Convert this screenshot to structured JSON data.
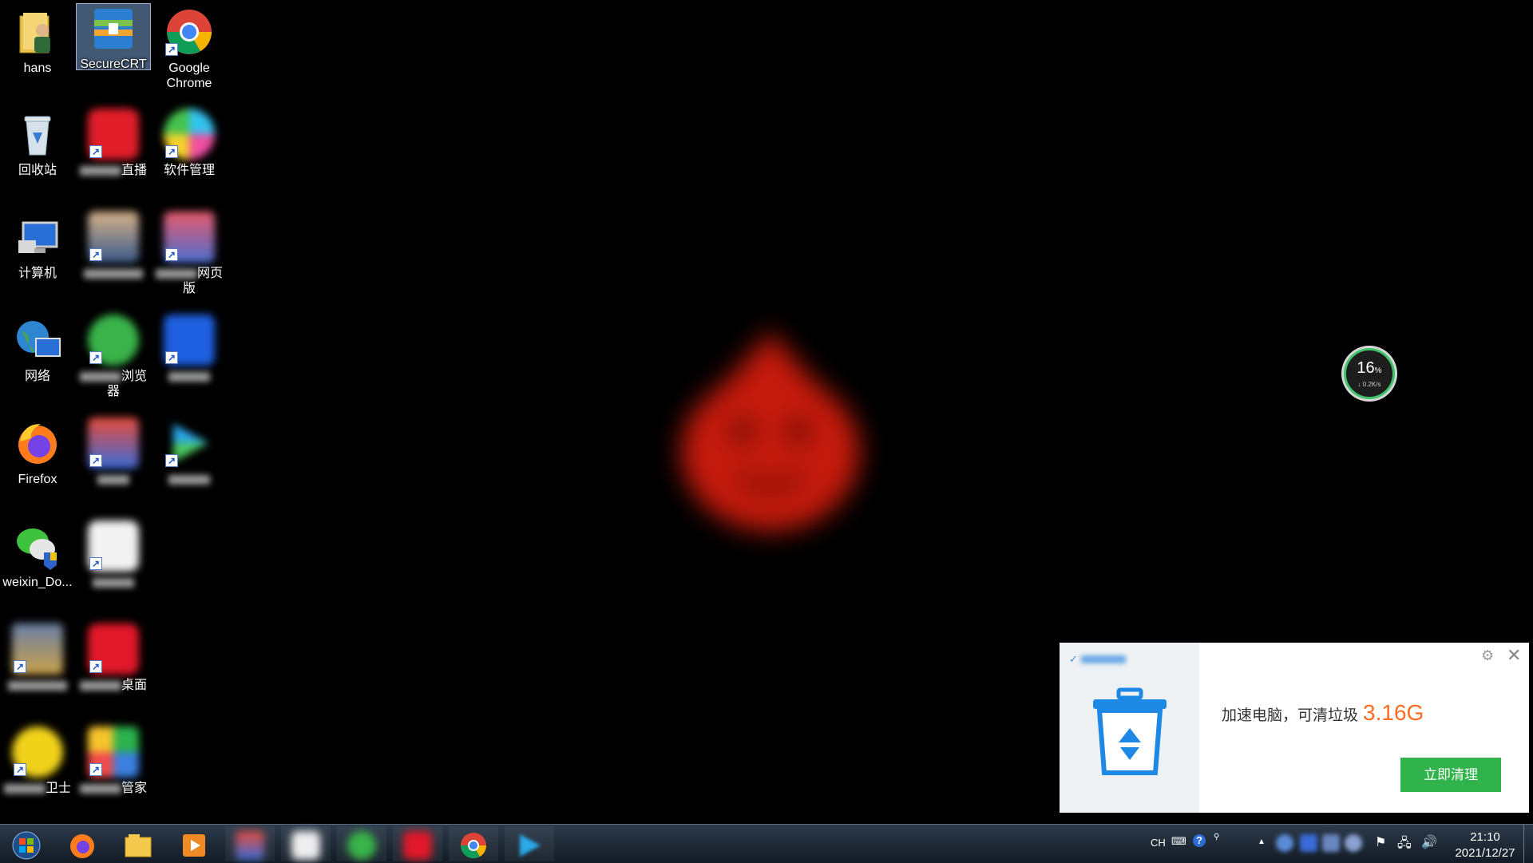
{
  "desktop": {
    "icons": {
      "hans": "hans",
      "securecrt": "SecureCRT",
      "chrome": "Google Chrome",
      "recycle": "回收站",
      "live_suffix": "直播",
      "software_mgr": "软件管理",
      "computer": "计算机",
      "web_suffix": "网页版",
      "network": "网络",
      "browser_suffix": "浏览器",
      "firefox": "Firefox",
      "weixin": "weixin_Do...",
      "desktop_suffix": "桌面",
      "guard_suffix": "卫士",
      "manager_suffix": "管家"
    }
  },
  "speed_ball": {
    "percent": "16",
    "percent_sign": "%",
    "net_speed": "↓ 0.2K/s"
  },
  "popup": {
    "message": "加速电脑，可清垃圾",
    "junk_size": "3.16G",
    "clean_button": "立即清理",
    "accent_color": "#ff6b21",
    "button_color": "#2fb34a"
  },
  "taskbar": {
    "input_lang": "CH",
    "time": "21:10",
    "date": "2021/12/27",
    "tray_overflow": "▲"
  }
}
